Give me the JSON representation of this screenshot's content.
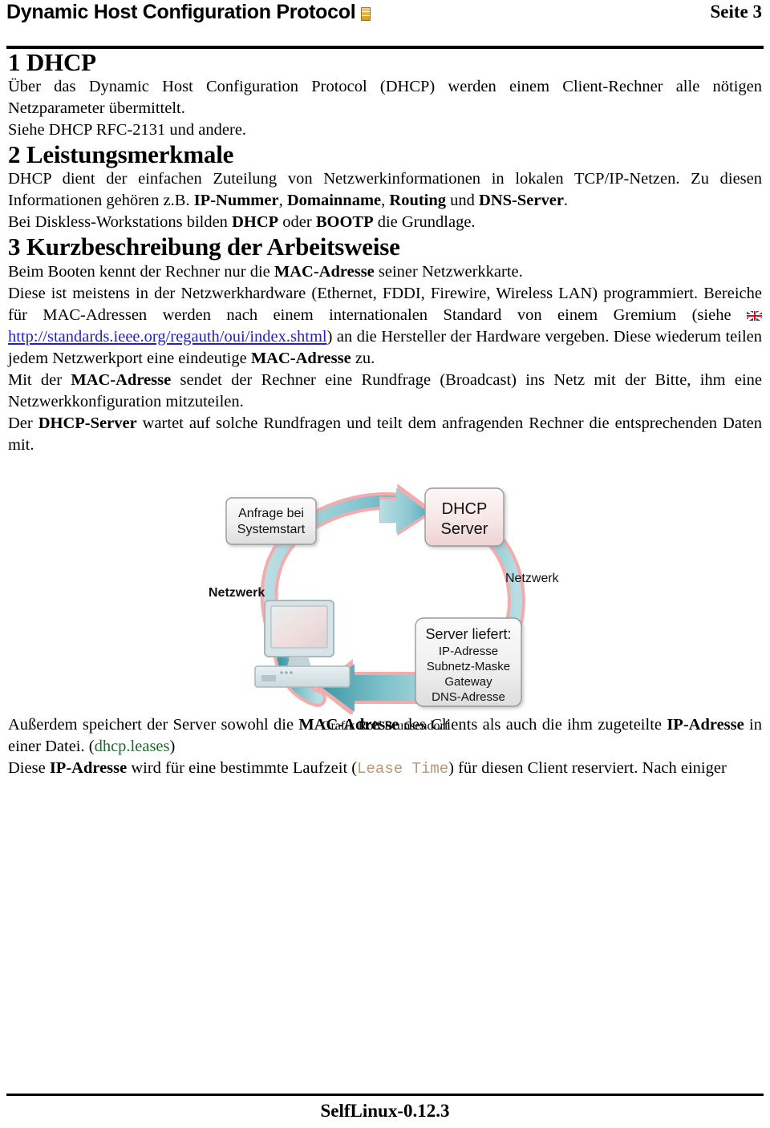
{
  "header": {
    "title": "Dynamic Host Configuration Protocol",
    "icon": "document-list-icon",
    "page_label": "Seite 3"
  },
  "sections": {
    "s1": {
      "heading": "1 DHCP",
      "p1_a": "Über das Dynamic Host Configuration Protocol (DHCP) werden einem Client-Rechner alle nötigen Netzparameter übermittelt.",
      "p2_a": "Siehe DHCP RFC-2131 und andere."
    },
    "s2": {
      "heading": "2 Leistungsmerkmale",
      "p1_a": "DHCP dient der einfachen Zuteilung von Netzwerkinformationen in lokalen TCP/IP-Netzen. Zu diesen Informationen gehören z.B. ",
      "p1_b1": "IP-Nummer",
      "p1_b2": ", ",
      "p1_b3": "Domainname",
      "p1_b4": ", ",
      "p1_b5": "Routing",
      "p1_b6": " und ",
      "p1_b7": "DNS-Server",
      "p1_b8": ".",
      "p2_a": "Bei Diskless-Workstations bilden ",
      "p2_b1": "DHCP",
      "p2_b2": " oder ",
      "p2_b3": "BOOTP",
      "p2_b4": " die Grundlage."
    },
    "s3": {
      "heading": "3 Kurzbeschreibung der Arbeitsweise",
      "p1_a": "Beim Booten kennt der Rechner nur die ",
      "p1_b": "MAC-Adresse",
      "p1_c": " seiner Netzwerkkarte.",
      "p2_a": "Diese ist meistens in der Netzwerkhardware (Ethernet, FDDI, Firewire, Wireless LAN) programmiert. Bereiche für MAC-Adressen werden nach einem internationalen Standard von einem Gremium (siehe ",
      "p2_flag": "uk-flag-icon",
      "p2_link": "http://standards.ieee.org/regauth/oui/index.shtml",
      "p2_b": ") an die Hersteller der Hardware vergeben. Diese wiederum teilen jedem Netzwerkport eine eindeutige ",
      "p2_c": "MAC-Adresse",
      "p2_d": " zu.",
      "p3_a": "Mit der ",
      "p3_b": "MAC-Adresse",
      "p3_c": " sendet der Rechner eine Rundfrage (Broadcast) ins Netz mit der Bitte, ihm eine Netzwerkkonfiguration mitzuteilen.",
      "p4_a": "Der ",
      "p4_b": "DHCP-Server",
      "p4_c": " wartet auf solche Rundfragen und teilt dem anfragenden Rechner die entsprechenden Daten mit.",
      "p5_a": "Außerdem speichert der Server sowohl die ",
      "p5_b": "MAC-Adresse",
      "p5_c": " des Clients als auch die ihm zugeteilte ",
      "p5_d": "IP-Adresse",
      "p5_e": " in einer Datei. (",
      "p5_f": "dhcp.leases",
      "p5_g": ")",
      "p6_a": "Diese ",
      "p6_b": "IP-Adresse",
      "p6_c": " wird für eine bestimmte Laufzeit (",
      "p6_d": "Lease Time",
      "p6_e": ") für diesen Client reserviert. Nach einiger"
    }
  },
  "figure": {
    "caption": "Grafik Rolf Brunsendorf",
    "box_request": {
      "line1": "Anfrage bei",
      "line2": "Systemstart"
    },
    "box_server": {
      "line1": "DHCP",
      "line2": "Server"
    },
    "box_delivers": {
      "title": "Server liefert:",
      "items": [
        "IP-Adresse",
        "Subnetz-Maske",
        "Gateway",
        "DNS-Adresse"
      ]
    },
    "label_network_left": "Netzwerk",
    "label_network_right": "Netzwerk",
    "client_icon": "desktop-computer-icon",
    "colors": {
      "arrow_fill": "#7fc2cc",
      "arrow_fill_dark": "#3f98a6",
      "arrow_outline": "#f0a8a8",
      "box_border": "#8a8a8a",
      "box_fill_light": "#f3f3f3",
      "box_fill_pink": "#f6e3e3",
      "monitor_fill": "#cfe0e4"
    }
  },
  "footer": {
    "text": "SelfLinux-0.12.3"
  }
}
